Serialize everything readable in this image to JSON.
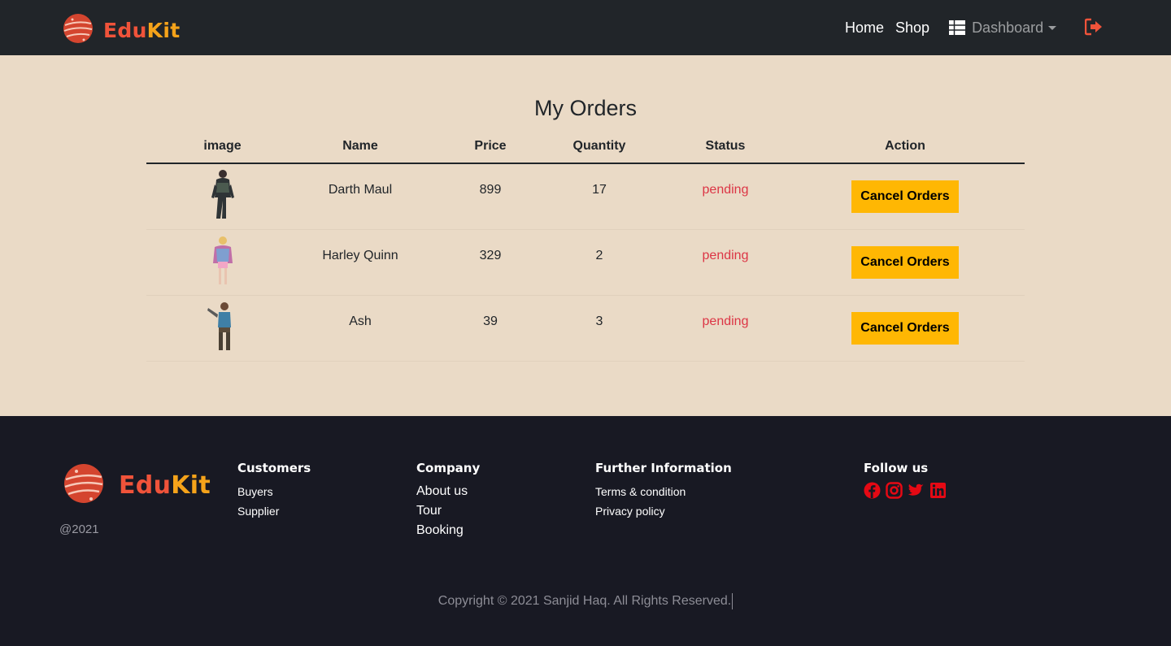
{
  "brand": {
    "part1": "Edu",
    "part2": "Kit",
    "logo_icon": "planet-logo-icon"
  },
  "nav": {
    "home": "Home",
    "shop": "Shop",
    "dashboard": "Dashboard",
    "dashboard_icon": "table-grid-icon",
    "logout_icon": "sign-out-icon"
  },
  "main": {
    "title": "My Orders",
    "columns": {
      "image": "image",
      "name": "Name",
      "price": "Price",
      "quantity": "Quantity",
      "status": "Status",
      "action": "Action"
    },
    "rows": [
      {
        "name": "Darth Maul",
        "price": "899",
        "quantity": "17",
        "status": "pending",
        "action": "Cancel Orders",
        "figure": "dark-warrior-figure"
      },
      {
        "name": "Harley Quinn",
        "price": "329",
        "quantity": "2",
        "status": "pending",
        "action": "Cancel Orders",
        "figure": "colorful-jacket-figure"
      },
      {
        "name": "Ash",
        "price": "39",
        "quantity": "3",
        "status": "pending",
        "action": "Cancel Orders",
        "figure": "chainsaw-hero-figure"
      }
    ]
  },
  "footer": {
    "year": "@2021",
    "customers": {
      "heading": "Customers",
      "links": [
        "Buyers",
        "Supplier"
      ]
    },
    "company": {
      "heading": "Company",
      "links": [
        "About us",
        "Tour",
        "Booking"
      ]
    },
    "further": {
      "heading": "Further Information",
      "links": [
        "Terms & condition",
        "Privacy policy"
      ]
    },
    "follow": {
      "heading": "Follow us",
      "icons": [
        "facebook-icon",
        "instagram-icon",
        "twitter-icon",
        "linkedin-icon"
      ]
    },
    "copyright": "Copyright © 2021 Sanjid Haq. All Rights Reserved."
  },
  "colors": {
    "nav_bg": "#212529",
    "page_bg": "#eadac6",
    "footer_bg": "#181923",
    "accent_red": "#f0533a",
    "accent_gold": "#f5a31a",
    "status_pending": "#dc3545",
    "button_bg": "#ffb703",
    "social_red": "#e50914"
  }
}
